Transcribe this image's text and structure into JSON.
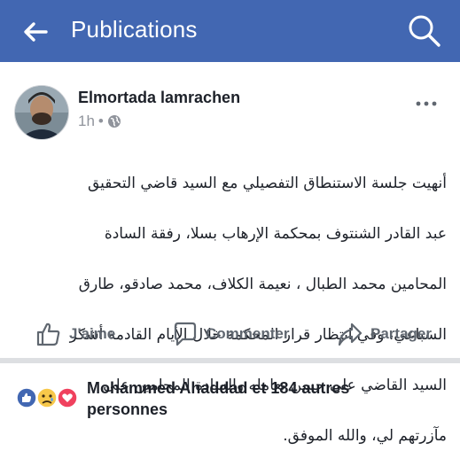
{
  "header": {
    "title": "Publications",
    "back_icon": "arrow-left-icon",
    "search_icon": "search-icon",
    "bar_color": "#4267b2"
  },
  "post": {
    "author": "Elmortada lamrachen",
    "time": "1h",
    "time_separator": "•",
    "privacy_icon": "globe-icon",
    "text_lines": [
      "أنهيت جلسة الاستنطاق التفصيلي مع السيد قاضي التحقيق",
      "عبد القادر الشنتوف بمحكمة الإرهاب بسلا، رفقة السادة",
      "المحامين محمد الطبال ، نعيمة الكلاف، محمد صادقو، طارق",
      "السباعي، وفي انتظار قرار المحكمة خلال الأيام القادمة أشكر",
      "السيد القاضي على حسن تعامله والسادة المحامين على",
      "مآزرتهم لي، والله الموفق."
    ]
  },
  "actions": {
    "like": "J'aime",
    "comment": "Commenter",
    "share": "Partager"
  },
  "reactions": {
    "icons": [
      "like-reaction-icon",
      "sad-reaction-icon",
      "love-reaction-icon"
    ],
    "line1": "Mohammed Ahaddad et 184 autres",
    "line2": "personnes"
  }
}
